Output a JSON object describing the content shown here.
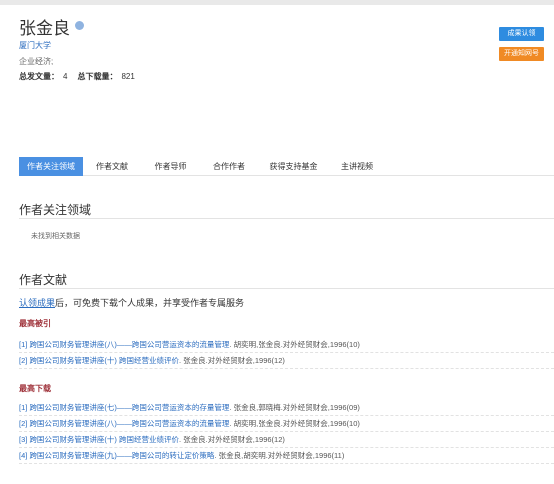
{
  "author": {
    "name": "张金良",
    "org": "厦门大学",
    "field": "企业经济;",
    "stats": {
      "total_label": "总发文量：",
      "total_value": "4",
      "downloads_label": "总下载量：",
      "downloads_value": "821"
    }
  },
  "buttons": {
    "claim": "成果认领",
    "notify": "开通知网号"
  },
  "tabs": [
    "作者关注领域",
    "作者文献",
    "作者导师",
    "合作作者",
    "获得支持基金",
    "主讲视频"
  ],
  "focus_section": {
    "title": "作者关注领域",
    "empty_text": "未找到相关数据"
  },
  "literature_section": {
    "title": "作者文献",
    "claim_link": "认领成果",
    "claim_rest": "后，可免费下载个人成果，并享受作者专属服务",
    "most_cited": {
      "label": "最高被引",
      "items": [
        {
          "idx": "[1]",
          "title": "跨国公司财务管理讲座(八)——跨国公司营运资本的流量管理",
          "meta": ". 胡奕明,张金良.对外经贸财会,1996(10)"
        },
        {
          "idx": "[2]",
          "title": "跨国公司财务管理讲座(十) 跨国经营业绩评价",
          "meta": ". 张金良.对外经贸财会,1996(12)"
        }
      ]
    },
    "most_downloaded": {
      "label": "最高下载",
      "items": [
        {
          "idx": "[1]",
          "title": "跨国公司财务管理讲座(七)——跨国公司营运资本的存量管理",
          "meta": ". 张金良,郭晓梅.对外经贸财会,1996(09)"
        },
        {
          "idx": "[2]",
          "title": "跨国公司财务管理讲座(八)——跨国公司营运资本的流量管理",
          "meta": ". 胡奕明,张金良.对外经贸财会,1996(10)"
        },
        {
          "idx": "[3]",
          "title": "跨国公司财务管理讲座(十) 跨国经营业绩评价",
          "meta": ". 张金良.对外经贸财会,1996(12)"
        },
        {
          "idx": "[4]",
          "title": "跨国公司财务管理讲座(九)——跨国公司的转让定价策略",
          "meta": ". 张金良,胡奕明.对外经贸财会,1996(11)"
        }
      ]
    }
  },
  "colors": {
    "accent": "#4a90e2",
    "link": "#2b6cbf",
    "subtitle_red": "#a0343c",
    "notify_orange": "#f08a24"
  }
}
